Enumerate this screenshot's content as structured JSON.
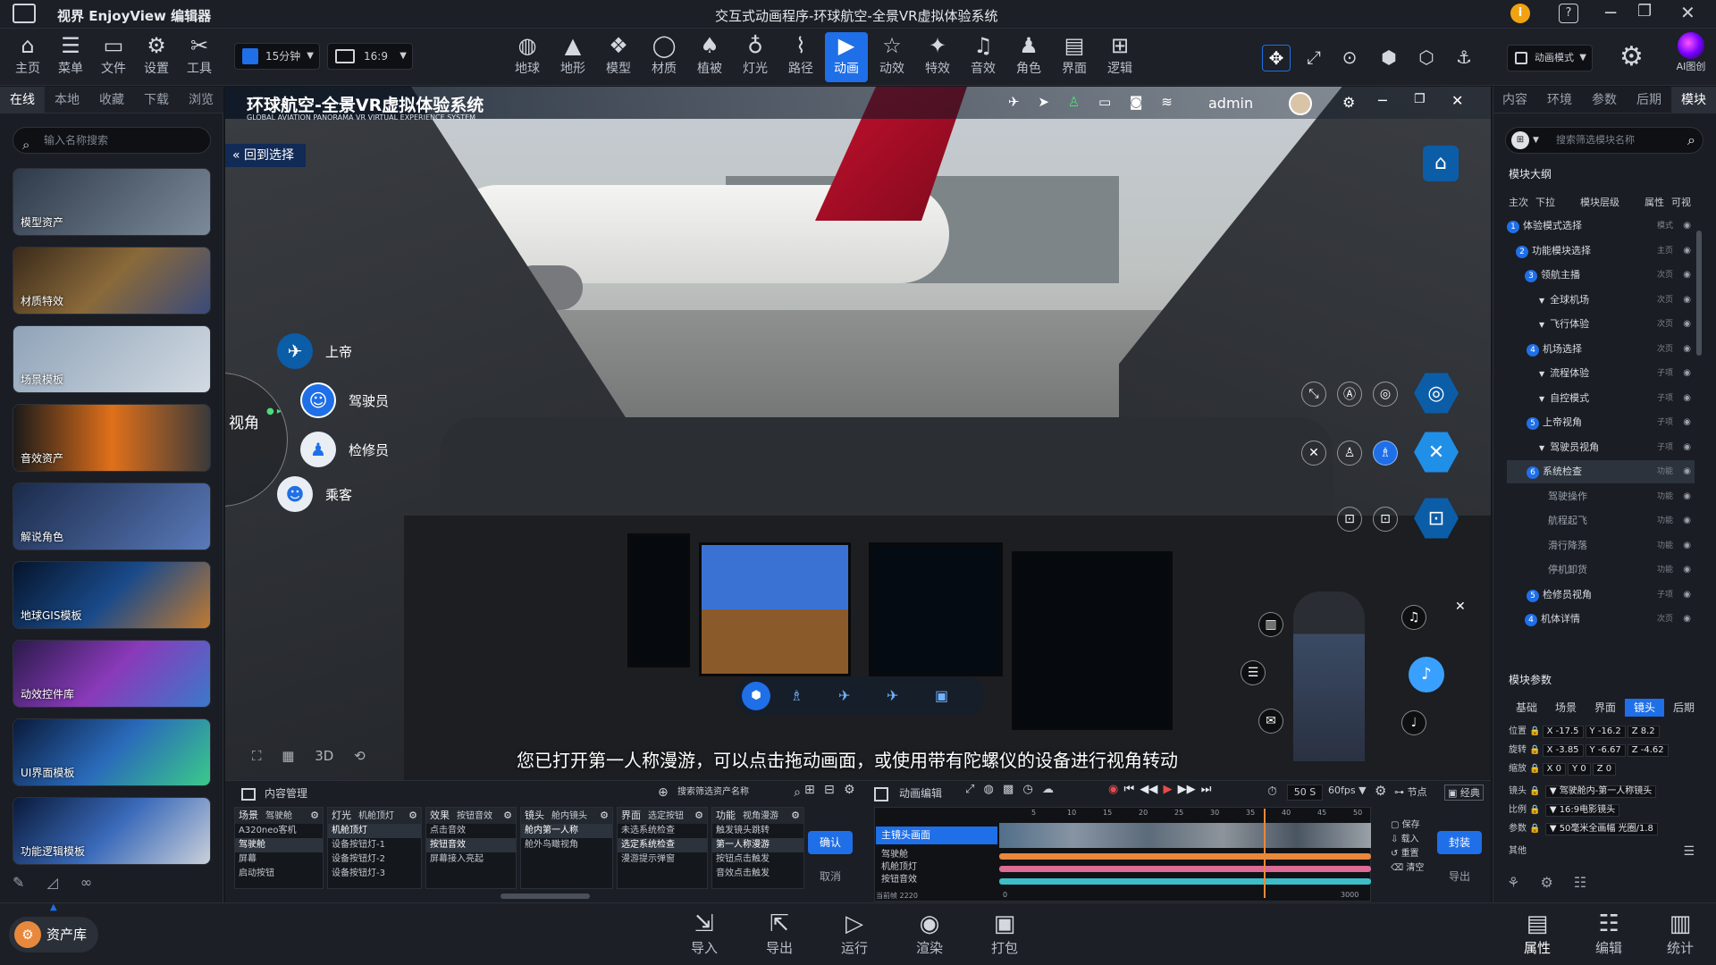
{
  "app": {
    "name": "视界 EnjoyView 编辑器",
    "window_title": "交互式动画程序-环球航空-全景VR虚拟体验系统"
  },
  "toolbar_left": [
    {
      "label": "主页",
      "icon": "home-icon",
      "glyph": "⌂"
    },
    {
      "label": "菜单",
      "icon": "menu-icon",
      "glyph": "☰"
    },
    {
      "label": "文件",
      "icon": "folder-icon",
      "glyph": "▭"
    },
    {
      "label": "设置",
      "icon": "gear-icon",
      "glyph": "⚙"
    },
    {
      "label": "工具",
      "icon": "tools-icon",
      "glyph": "✂"
    }
  ],
  "duration_select": "15分钟",
  "ratio_select": "16:9",
  "toolbar_center": [
    {
      "label": "地球",
      "icon": "globe-icon",
      "glyph": "◍"
    },
    {
      "label": "地形",
      "icon": "terrain-icon",
      "glyph": "▲"
    },
    {
      "label": "模型",
      "icon": "cubes-icon",
      "glyph": "❖"
    },
    {
      "label": "材质",
      "icon": "sphere-icon",
      "glyph": "◯"
    },
    {
      "label": "植被",
      "icon": "tree-icon",
      "glyph": "♠"
    },
    {
      "label": "灯光",
      "icon": "bulb-icon",
      "glyph": "♁"
    },
    {
      "label": "路径",
      "icon": "path-icon",
      "glyph": "⌇"
    },
    {
      "label": "动画",
      "icon": "camera-icon",
      "glyph": "▶"
    },
    {
      "label": "动效",
      "icon": "star-icon",
      "glyph": "☆"
    },
    {
      "label": "特效",
      "icon": "sparkle-icon",
      "glyph": "✦"
    },
    {
      "label": "音效",
      "icon": "music-icon",
      "glyph": "♫"
    },
    {
      "label": "角色",
      "icon": "person-icon",
      "glyph": "♟"
    },
    {
      "label": "界面",
      "icon": "layout-icon",
      "glyph": "▤"
    },
    {
      "label": "逻辑",
      "icon": "logic-icon",
      "glyph": "⊞"
    }
  ],
  "mode_select": "动画模式",
  "ai_label": "AI图创",
  "left_tabs": [
    "在线",
    "本地",
    "收藏",
    "下载",
    "浏览"
  ],
  "left_search_placeholder": "输入名称搜索",
  "assets": [
    "模型资产",
    "材质特效",
    "场景模板",
    "音效资产",
    "解说角色",
    "地球GIS模板",
    "动效控件库",
    "UI界面模板",
    "功能逻辑模板"
  ],
  "asset_library": "资产库",
  "vr": {
    "title": "环球航空-全景VR虚拟体验系统",
    "subtitle": "GLOBAL AVIATION PANORAMA VR VIRTUAL EXPERIENCE SYSTEM",
    "user": "admin",
    "back": "回到选择",
    "view_label": "视角",
    "roles": [
      "上帝",
      "驾驶员",
      "检修员",
      "乘客"
    ],
    "subtitle_caption": "您已打开第一人称漫游，可以点击拖动画面，或使用带有陀螺仪的设备进行视角转动",
    "mode_3d": "3D"
  },
  "right_tabs": [
    "内容",
    "环境",
    "参数",
    "后期",
    "模块"
  ],
  "right_search_placeholder": "搜索筛选模块名称",
  "outline": {
    "title": "模块大纲",
    "headers": [
      "主次",
      "下拉",
      "模块层级",
      "属性",
      "可视"
    ],
    "rows": [
      {
        "num": "1",
        "label": "体验模式选择",
        "tag": "模式"
      },
      {
        "num": "2",
        "label": "功能模块选择",
        "tag": "主页"
      },
      {
        "num": "3",
        "label": "领航主播",
        "tag": "次页"
      },
      {
        "num": "",
        "label": "全球机场",
        "tag": "次页"
      },
      {
        "num": "",
        "label": "飞行体验",
        "tag": "次页"
      },
      {
        "num": "4",
        "label": "机场选择",
        "tag": "次页"
      },
      {
        "num": "",
        "label": "流程体验",
        "tag": "子项"
      },
      {
        "num": "",
        "label": "自控模式",
        "tag": "子项"
      },
      {
        "num": "5",
        "label": "上帝视角",
        "tag": "子项"
      },
      {
        "num": "",
        "label": "驾驶员视角",
        "tag": "子项"
      },
      {
        "num": "6",
        "label": "系统检查",
        "tag": "功能"
      },
      {
        "num": "",
        "label": "驾驶操作",
        "tag": "功能"
      },
      {
        "num": "",
        "label": "航程起飞",
        "tag": "功能"
      },
      {
        "num": "",
        "label": "滑行降落",
        "tag": "功能"
      },
      {
        "num": "",
        "label": "停机卸货",
        "tag": "功能"
      },
      {
        "num": "5",
        "label": "检修员视角",
        "tag": "子项"
      },
      {
        "num": "4",
        "label": "机体详情",
        "tag": "次页"
      }
    ]
  },
  "params": {
    "title": "模块参数",
    "tabs": [
      "基础",
      "场景",
      "界面",
      "镜头",
      "后期"
    ],
    "position": {
      "label": "位置",
      "x": "-17.5",
      "y": "-16.2",
      "z": "8.2"
    },
    "rotation": {
      "label": "旋转",
      "x": "-3.85",
      "y": "-6.67",
      "z": "-4.62"
    },
    "scale": {
      "label": "缩放",
      "x": "0",
      "y": "0",
      "z": "0"
    },
    "lens": {
      "label": "镜头",
      "value": "驾驶舱内-第一人称镜头"
    },
    "ratio": {
      "label": "比例",
      "value": "16:9电影镜头"
    },
    "param": {
      "label": "参数",
      "value": "50毫米全画幅 光圈/1.8"
    },
    "other": "其他"
  },
  "content_mgmt": {
    "title": "内容管理",
    "search_placeholder": "搜索筛选资产名称",
    "cols": [
      {
        "h1": "场景",
        "h2": "驾驶舱",
        "items": [
          "A320neo客机",
          "驾驶舱",
          "屏幕",
          "启动按钮"
        ],
        "sel": 1
      },
      {
        "h1": "灯光",
        "h2": "机舱顶灯",
        "items": [
          "机舱顶灯",
          "设备按钮灯-1",
          "设备按钮灯-2",
          "设备按钮灯-3"
        ],
        "sel": 0
      },
      {
        "h1": "效果",
        "h2": "按钮音效",
        "items": [
          "点击音效",
          "按钮音效",
          "屏幕接入亮起"
        ],
        "sel": 1
      },
      {
        "h1": "镜头",
        "h2": "舱内镜头",
        "items": [
          "舱内第一人称",
          "舱外鸟瞰视角"
        ],
        "sel": 0
      },
      {
        "h1": "界面",
        "h2": "选定按钮",
        "items": [
          "未选系统检查",
          "选定系统检查",
          "漫游提示弹窗"
        ],
        "sel": 1
      },
      {
        "h1": "功能",
        "h2": "视角漫游",
        "items": [
          "触发镜头跳转",
          "第一人称漫游",
          "按钮点击触发",
          "音效点击触发"
        ],
        "sel": 1
      }
    ],
    "confirm": "确认",
    "cancel": "取消"
  },
  "anim_edit": {
    "title": "动画编辑",
    "seconds": "50 S",
    "fps": "60fps",
    "node": "节点",
    "classic": "经典",
    "tracks": [
      "主镜头画面",
      "驾驶舱",
      "机舱顶灯",
      "按钮音效"
    ],
    "ticks": [
      "5",
      "10",
      "15",
      "20",
      "25",
      "30",
      "35",
      "40",
      "45",
      "50"
    ],
    "current_frame": "2220",
    "frame_start": "0",
    "frame_end": "3000",
    "save": "保存",
    "load": "载入",
    "reset": "重置",
    "clear": "清空",
    "seal": "封装",
    "export": "导出"
  },
  "footer_center": [
    {
      "label": "导入",
      "glyph": "⇲",
      "icon": "import-icon"
    },
    {
      "label": "导出",
      "glyph": "⇱",
      "icon": "export-icon"
    },
    {
      "label": "运行",
      "glyph": "▷",
      "icon": "play-icon"
    },
    {
      "label": "渲染",
      "glyph": "◉",
      "icon": "render-icon"
    },
    {
      "label": "打包",
      "glyph": "▣",
      "icon": "package-icon"
    }
  ],
  "footer_right": [
    {
      "label": "属性",
      "glyph": "▤",
      "icon": "properties-icon"
    },
    {
      "label": "编辑",
      "glyph": "☷",
      "icon": "edit-icon"
    },
    {
      "label": "统计",
      "glyph": "▥",
      "icon": "stats-icon"
    }
  ],
  "colors": {
    "accent": "#1f6fe8",
    "bg": "#14171c",
    "panel": "#1a1d23"
  }
}
